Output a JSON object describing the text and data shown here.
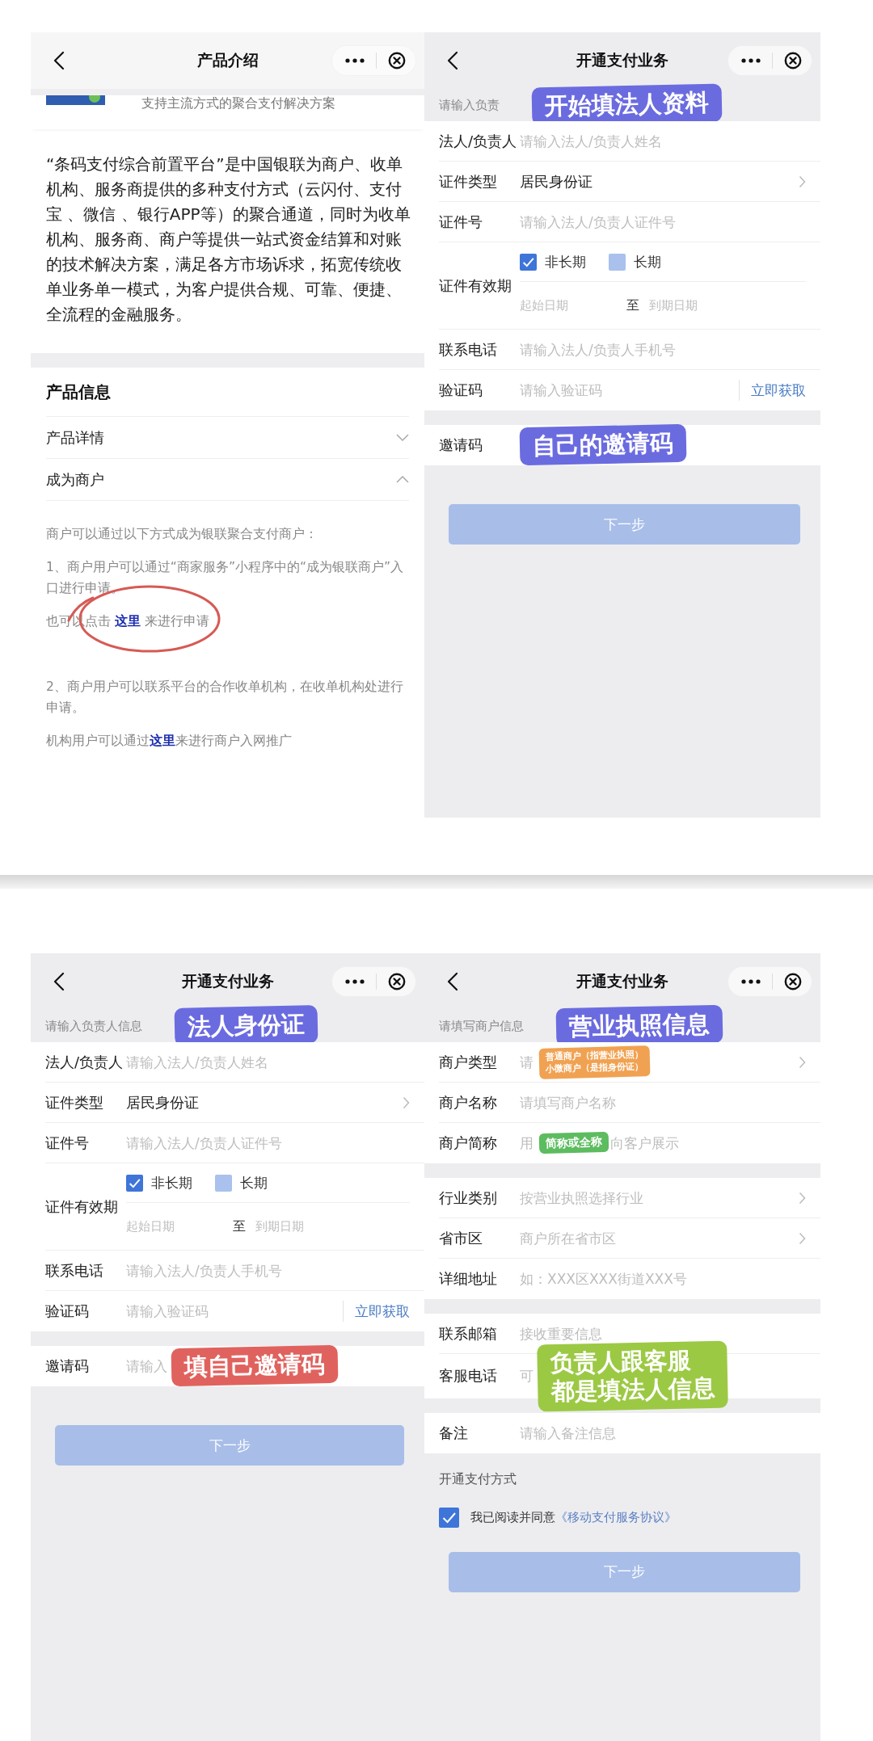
{
  "screens": [
    {
      "kind": "intro",
      "nav": {
        "title": "产品介绍"
      },
      "banner": {
        "text": "支持主流方式的聚合支付解决方案"
      },
      "description": "“条码支付综合前置平台”是中国银联为商户、收单机构、服务商提供的多种支付方式（云闪付、支付宝 、微信 、银行APP等）的聚合通道，同时为收单机构、服务商、商户等提供一站式资金结算和对账的技术解决方案，满足各方市场诉求，拓宽传统收单业务单一模式，为客户提供合规、可靠、便捷、全流程的金融服务。",
      "section": {
        "title": "产品信息",
        "items": [
          {
            "label": "产品详情",
            "expanded": false
          },
          {
            "label": "成为商户",
            "expanded": true,
            "content": [
              {
                "text": "商户可以通过以下方式成为银联聚合支付商户："
              },
              {
                "text": "1、商户用户可以通过“商家服务”小程序中的“成为银联商户”入口进行申请。"
              },
              {
                "text": "也可以点击 ",
                "link": "这里",
                "after": " 来进行申请",
                "circled": true
              },
              {
                "text": "2、商户用户可以联系平台的合作收单机构，在收单机构处进行申请。"
              },
              {
                "text": "机构用户可以通过",
                "link": "这里",
                "after": "来进行商户入网推广"
              }
            ]
          }
        ]
      }
    },
    {
      "kind": "form",
      "nav": {
        "title": "开通支付业务"
      },
      "subheader": {
        "text": "请输入负责",
        "note": {
          "kind": "callout",
          "text": "开始填法人资料",
          "color": "#6b6be0"
        }
      },
      "sections": [
        {
          "rows": [
            {
              "kind": "input",
              "label": "法人/负责人",
              "placeholder": "请输入法人/负责人姓名"
            },
            {
              "kind": "select",
              "label": "证件类型",
              "value": "居民身份证"
            },
            {
              "kind": "input",
              "label": "证件号",
              "placeholder": "请输入法人/负责人证件号"
            },
            {
              "kind": "validity",
              "label": "证件有效期",
              "options": [
                {
                  "label": "非长期",
                  "checked": true
                },
                {
                  "label": "长期",
                  "checked": false
                }
              ],
              "start_placeholder": "起始日期",
              "separator": "至",
              "end_placeholder": "到期日期"
            },
            {
              "kind": "input",
              "label": "联系电话",
              "placeholder": "请输入法人/负责人手机号"
            },
            {
              "kind": "code",
              "label": "验证码",
              "placeholder": "请输入验证码",
              "action": "立即获取"
            }
          ]
        },
        {
          "rows": [
            {
              "kind": "input",
              "label": "邀请码",
              "note": {
                "kind": "callout",
                "text": "自己的邀请码",
                "color": "#6b6be0"
              }
            }
          ]
        }
      ],
      "button": {
        "label": "下一步",
        "disabled": true
      }
    },
    {
      "kind": "form",
      "nav": {
        "title": "开通支付业务"
      },
      "subheader": {
        "text": "请输入负责人信息",
        "note": {
          "kind": "callout",
          "text": "法人身份证",
          "color": "#6b6be0"
        }
      },
      "sections": [
        {
          "rows": [
            {
              "kind": "input",
              "label": "法人/负责人",
              "placeholder": "请输入法人/负责人姓名"
            },
            {
              "kind": "select",
              "label": "证件类型",
              "value": "居民身份证"
            },
            {
              "kind": "input",
              "label": "证件号",
              "placeholder": "请输入法人/负责人证件号"
            },
            {
              "kind": "validity",
              "label": "证件有效期",
              "options": [
                {
                  "label": "非长期",
                  "checked": true
                },
                {
                  "label": "长期",
                  "checked": false
                }
              ],
              "start_placeholder": "起始日期",
              "separator": "至",
              "end_placeholder": "到期日期"
            },
            {
              "kind": "input",
              "label": "联系电话",
              "placeholder": "请输入法人/负责人手机号"
            },
            {
              "kind": "code",
              "label": "验证码",
              "placeholder": "请输入验证码",
              "action": "立即获取"
            }
          ]
        },
        {
          "rows": [
            {
              "kind": "input",
              "label": "邀请码",
              "placeholder": "请输入",
              "note": {
                "kind": "callout",
                "text": "填自己邀请码",
                "color": "#e0625e"
              }
            }
          ]
        }
      ],
      "button": {
        "label": "下一步",
        "disabled": true
      }
    },
    {
      "kind": "form",
      "nav": {
        "title": "开通支付业务"
      },
      "subheader": {
        "text": "请填写商户信息",
        "note": {
          "kind": "callout",
          "text": "营业执照信息",
          "color": "#6b6be0"
        }
      },
      "sections": [
        {
          "rows": [
            {
              "kind": "select",
              "label": "商户类型",
              "placeholder": "请",
              "note": {
                "kind": "tag",
                "lines": [
                  "普通商户（指营业执照）",
                  "小微商户（是指身份证）"
                ],
                "color": "#f0a252"
              }
            },
            {
              "kind": "input",
              "label": "商户名称",
              "placeholder": "请填写商户名称"
            },
            {
              "kind": "input",
              "label": "商户简称",
              "placeholder": "用",
              "note": {
                "kind": "tag",
                "text": "简称或全称",
                "color": "#5cbc5f"
              },
              "placeholder_end": "向客户展示"
            }
          ]
        },
        {
          "rows": [
            {
              "kind": "select",
              "label": "行业类别",
              "placeholder": "按营业执照选择行业"
            },
            {
              "kind": "select",
              "label": "省市区",
              "placeholder": "商户所在省市区"
            },
            {
              "kind": "input",
              "label": "详细地址",
              "placeholder": "如：XXX区XXX街道XXX号"
            }
          ]
        },
        {
          "rows": [
            {
              "kind": "input",
              "label": "联系邮箱",
              "placeholder": "接收重要信息"
            },
            {
              "kind": "input",
              "label": "客服电话",
              "placeholder": "可",
              "note": {
                "kind": "callout",
                "lines": [
                  "负责人跟客服",
                  "都是填法人信息"
                ],
                "color": "#9cc944"
              }
            }
          ]
        },
        {
          "rows": [
            {
              "kind": "input",
              "label": "备注",
              "placeholder": "请输入备注信息"
            }
          ]
        }
      ],
      "extra": {
        "heading": "开通支付方式",
        "agreement": {
          "checked": true,
          "text": "我已阅读并同意",
          "link": "《移动支付服务协议》"
        }
      },
      "button": {
        "label": "下一步",
        "disabled": true
      }
    }
  ]
}
